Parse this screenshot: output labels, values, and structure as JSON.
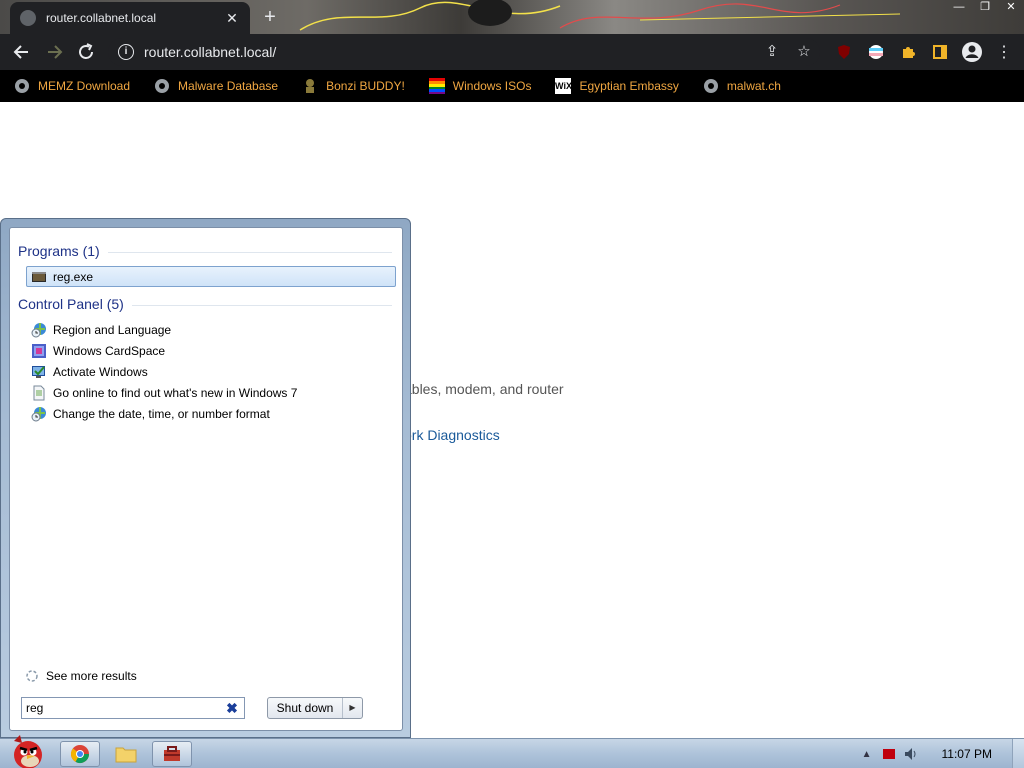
{
  "browser": {
    "tab_title": "router.collabnet.local",
    "url": "router.collabnet.local/",
    "bookmarks": [
      {
        "label": "MEMZ Download",
        "icon": "globe-icon"
      },
      {
        "label": "Malware Database",
        "icon": "globe-icon"
      },
      {
        "label": "Bonzi BUDDY!",
        "icon": "bonzi-icon"
      },
      {
        "label": "Windows ISOs",
        "icon": "windows-flag-icon"
      },
      {
        "label": "Egyptian Embassy",
        "icon": "wix-icon"
      },
      {
        "label": "malwat.ch",
        "icon": "globe-icon"
      }
    ],
    "wix_text": "WiX"
  },
  "page": {
    "line1": "ables, modem, and router",
    "line2": "ork Diagnostics"
  },
  "start_menu": {
    "programs_header": "Programs (1)",
    "programs": [
      {
        "label": "reg.exe",
        "icon": "reg-exe-icon",
        "selected": true
      }
    ],
    "control_panel_header": "Control Panel (5)",
    "control_panel": [
      {
        "label": "Region and Language",
        "icon": "globe-clock-icon"
      },
      {
        "label": "Windows CardSpace",
        "icon": "cardspace-icon"
      },
      {
        "label": "Activate Windows",
        "icon": "action-center-icon"
      },
      {
        "label": "Go online to find out what's new in Windows 7",
        "icon": "document-icon"
      },
      {
        "label": "Change the date, time, or number format",
        "icon": "globe-clock-icon"
      }
    ],
    "see_more": "See more results",
    "search_value": "reg",
    "shutdown_label": "Shut down"
  },
  "taskbar": {
    "clock": "11:07 PM"
  },
  "colors": {
    "bookmark_text": "#f0a742",
    "group_header": "#1e3287",
    "page_link": "#1a5a9a"
  }
}
